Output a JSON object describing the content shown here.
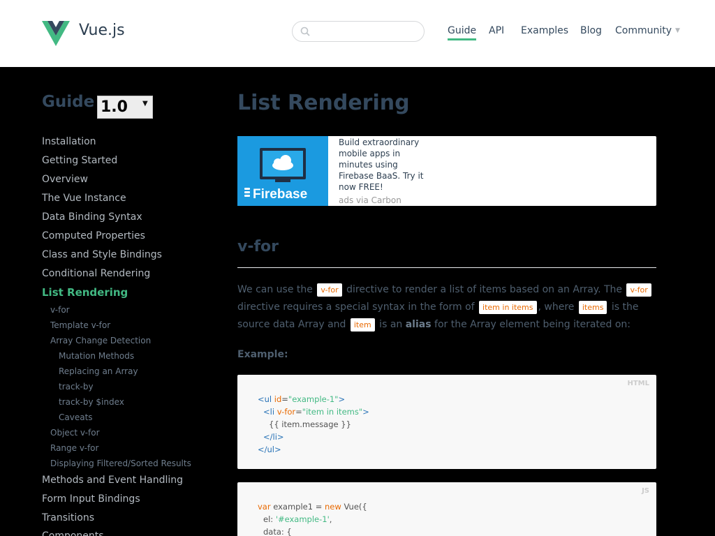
{
  "header": {
    "brand": "Vue.js",
    "search": {
      "placeholder": ""
    },
    "nav": [
      "Guide",
      "API",
      "Examples",
      "Blog",
      "Community"
    ]
  },
  "sidebar": {
    "title": "Guide",
    "version": "1.0",
    "items_top": [
      "Installation",
      "Getting Started",
      "Overview",
      "The Vue Instance",
      "Data Binding Syntax",
      "Computed Properties",
      "Class and Style Bindings",
      "Conditional Rendering"
    ],
    "current": "List Rendering",
    "sub_items": [
      "v-for",
      "Template v-for",
      "Array Change Detection",
      "Mutation Methods",
      "Replacing an Array",
      "track-by",
      "track-by $index",
      "Caveats",
      "Object v-for",
      "Range v-for",
      "Displaying Filtered/Sorted Results"
    ],
    "items_bottom": [
      "Methods and Event Handling",
      "Form Input Bindings",
      "Transitions",
      "Components"
    ]
  },
  "content": {
    "title": "List Rendering",
    "ad": {
      "brand": "Firebase",
      "text": "Build extraordinary mobile apps in minutes using Firebase BaaS. Try it now FREE!",
      "via": "ads via Carbon"
    },
    "section_title": "v-for",
    "paragraph": {
      "t1": "We can use the ",
      "c1": "v-for",
      "t2": " directive to render a list of items based on an Array. The ",
      "c2": "v-for",
      "t3": " directive requires a special syntax in the form of ",
      "c3": "item in items",
      "t4": ", where ",
      "c4": "items",
      "t5": " is the source data Array and ",
      "c5": "item",
      "t6": " is an ",
      "strong": "alias",
      "t7": " for the Array element being iterated on:"
    },
    "example_label": "Example:",
    "html_block": {
      "lang": "HTML",
      "l1_tag": "<ul ",
      "l1_attr": "id",
      "l1_eq": "=",
      "l1_str": "\"example-1\"",
      "l1_end": ">",
      "l2_tag": "<li ",
      "l2_attr": "v-for",
      "l2_eq": "=",
      "l2_str": "\"item in items\"",
      "l2_end": ">",
      "l3": "{{ item.message }}",
      "l4": "</li>",
      "l5": "</ul>"
    },
    "js_block": {
      "lang": "JS",
      "l1_kw": "var",
      "l1_mid": " example1 = ",
      "l1_kw2": "new",
      "l1_end": " Vue({",
      "l2_key": "el: ",
      "l2_str": "'#example-1'",
      "l2_end": ",",
      "l3": "data: {"
    }
  }
}
